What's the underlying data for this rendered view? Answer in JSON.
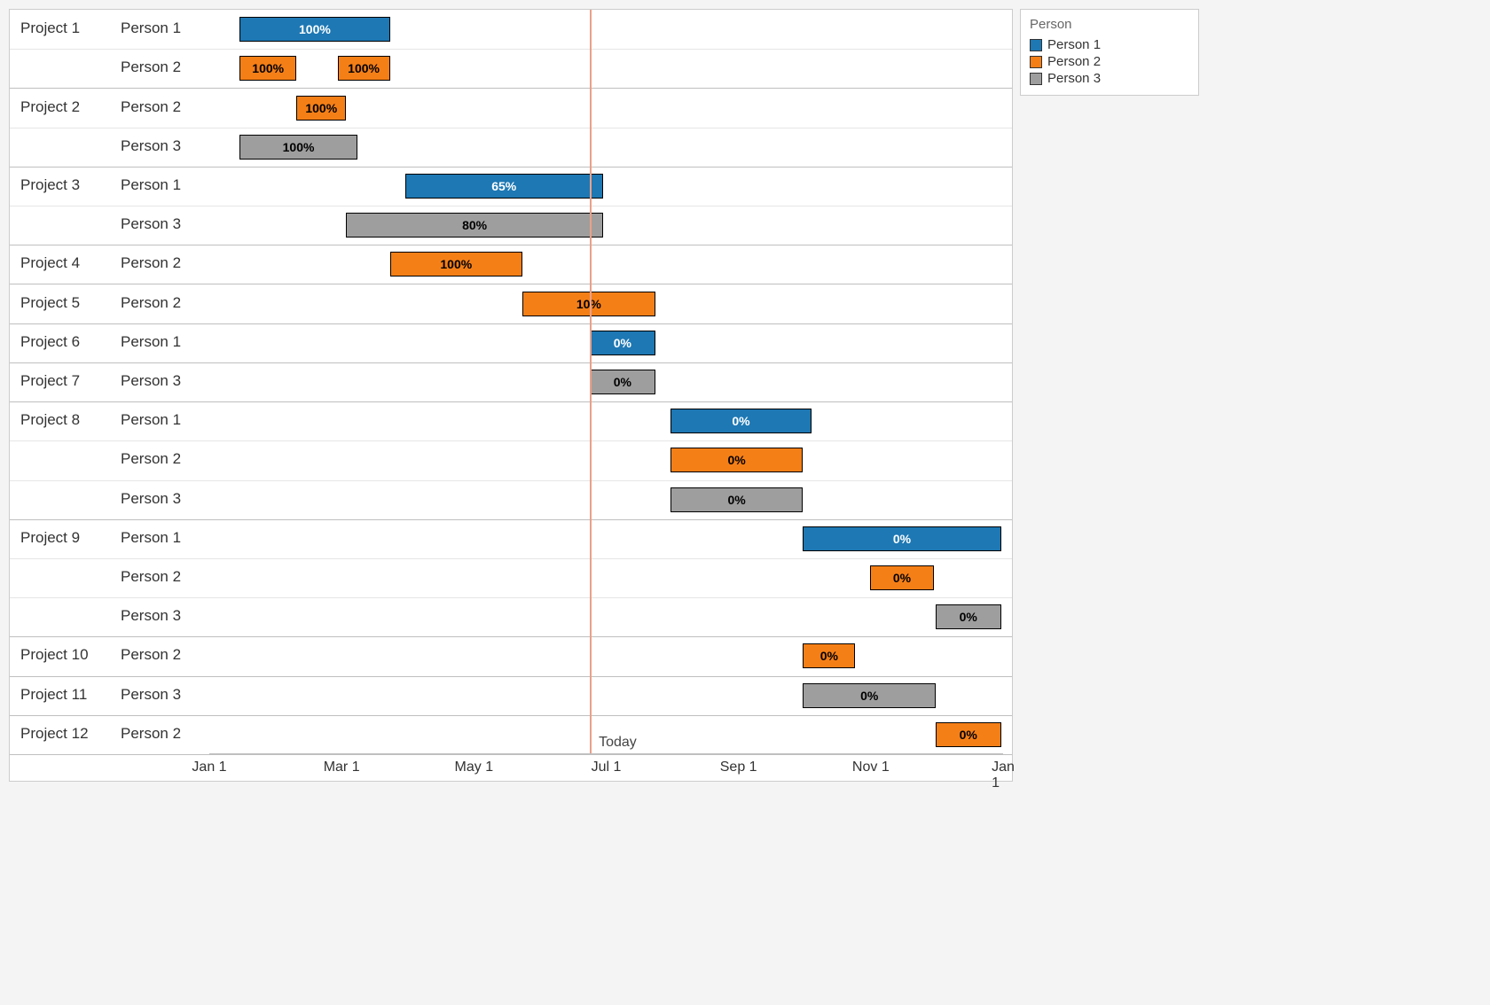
{
  "chart_data": {
    "type": "gantt",
    "title": "",
    "x_axis": {
      "start": "2021-01-01",
      "end": "2022-01-01",
      "ticks": [
        "Jan 1",
        "Mar 1",
        "May 1",
        "Jul 1",
        "Sep 1",
        "Nov 1",
        "Jan 1"
      ]
    },
    "today": "2021-06-25",
    "today_label": "Today",
    "legend": {
      "title": "Person",
      "items": [
        {
          "name": "Person 1",
          "color": "#1d78b4"
        },
        {
          "name": "Person 2",
          "color": "#f57f17"
        },
        {
          "name": "Person 3",
          "color": "#9e9e9e"
        }
      ]
    },
    "colors": {
      "Person 1": "#1d78b4",
      "Person 2": "#f57f17",
      "Person 3": "#9e9e9e"
    },
    "text_colors": {
      "Person 1": "#ffffff",
      "Person 2": "#000000",
      "Person 3": "#000000"
    },
    "projects": [
      {
        "name": "Project 1",
        "tasks": [
          {
            "person": "Person 1",
            "start": "2021-01-15",
            "end": "2021-03-25",
            "progress": "100%"
          },
          {
            "person": "Person 2",
            "segments": [
              {
                "start": "2021-01-15",
                "end": "2021-02-10",
                "progress": "100%"
              },
              {
                "start": "2021-03-01",
                "end": "2021-03-25",
                "progress": "100%"
              }
            ]
          }
        ]
      },
      {
        "name": "Project 2",
        "tasks": [
          {
            "person": "Person 2",
            "start": "2021-02-10",
            "end": "2021-03-05",
            "progress": "100%"
          },
          {
            "person": "Person 3",
            "start": "2021-01-15",
            "end": "2021-03-10",
            "progress": "100%"
          }
        ]
      },
      {
        "name": "Project 3",
        "tasks": [
          {
            "person": "Person 1",
            "start": "2021-04-01",
            "end": "2021-07-01",
            "progress": "65%"
          },
          {
            "person": "Person 3",
            "start": "2021-03-05",
            "end": "2021-07-01",
            "progress": "80%"
          }
        ]
      },
      {
        "name": "Project 4",
        "tasks": [
          {
            "person": "Person 2",
            "start": "2021-03-25",
            "end": "2021-05-25",
            "progress": "100%"
          }
        ]
      },
      {
        "name": "Project 5",
        "tasks": [
          {
            "person": "Person 2",
            "start": "2021-05-25",
            "end": "2021-07-25",
            "progress": "10%"
          }
        ]
      },
      {
        "name": "Project 6",
        "tasks": [
          {
            "person": "Person 1",
            "start": "2021-06-25",
            "end": "2021-07-25",
            "progress": "0%"
          }
        ]
      },
      {
        "name": "Project 7",
        "tasks": [
          {
            "person": "Person 3",
            "start": "2021-06-25",
            "end": "2021-07-25",
            "progress": "0%"
          }
        ]
      },
      {
        "name": "Project 8",
        "tasks": [
          {
            "person": "Person 1",
            "start": "2021-08-01",
            "end": "2021-10-05",
            "progress": "0%"
          },
          {
            "person": "Person 2",
            "start": "2021-08-01",
            "end": "2021-10-01",
            "progress": "0%"
          },
          {
            "person": "Person 3",
            "start": "2021-08-01",
            "end": "2021-10-01",
            "progress": "0%"
          }
        ]
      },
      {
        "name": "Project 9",
        "tasks": [
          {
            "person": "Person 1",
            "start": "2021-10-01",
            "end": "2021-12-31",
            "progress": "0%"
          },
          {
            "person": "Person 2",
            "start": "2021-11-01",
            "end": "2021-11-30",
            "progress": "0%"
          },
          {
            "person": "Person 3",
            "start": "2021-12-01",
            "end": "2021-12-31",
            "progress": "0%"
          }
        ]
      },
      {
        "name": "Project 10",
        "tasks": [
          {
            "person": "Person 2",
            "start": "2021-10-01",
            "end": "2021-10-25",
            "progress": "0%"
          }
        ]
      },
      {
        "name": "Project 11",
        "tasks": [
          {
            "person": "Person 3",
            "start": "2021-10-01",
            "end": "2021-12-01",
            "progress": "0%"
          }
        ]
      },
      {
        "name": "Project 12",
        "tasks": [
          {
            "person": "Person 2",
            "start": "2021-12-01",
            "end": "2021-12-31",
            "progress": "0%"
          }
        ]
      }
    ]
  }
}
